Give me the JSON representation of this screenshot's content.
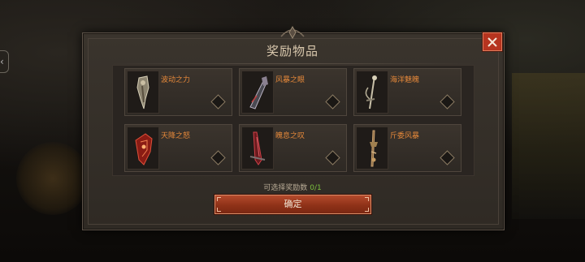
{
  "dialog": {
    "title": "奖励物品",
    "close_icon": "close-x-icon",
    "items": [
      {
        "name": "波动之力",
        "icon": "bone-claw-icon"
      },
      {
        "name": "风暴之眼",
        "icon": "dark-claw-icon"
      },
      {
        "name": "海洋魅魄",
        "icon": "trident-staff-icon"
      },
      {
        "name": "天降之怒",
        "icon": "red-gauntlet-icon"
      },
      {
        "name": "魄息之叹",
        "icon": "red-blade-icon"
      },
      {
        "name": "斤委风暴",
        "icon": "bronze-spear-icon"
      }
    ],
    "selection_label": "可选择奖励数",
    "selection_value": "0/1",
    "confirm_label": "确定"
  },
  "colors": {
    "accent_red": "#b44a2c",
    "item_name": "#e5883a",
    "count_green": "#7bbf3d"
  }
}
